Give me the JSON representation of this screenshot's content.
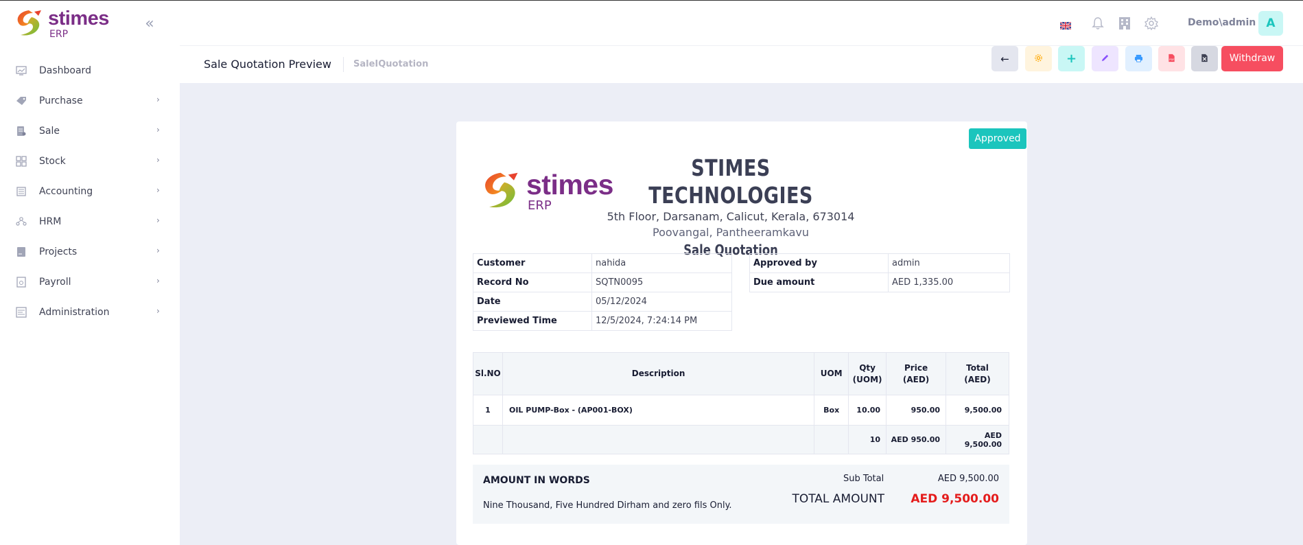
{
  "app": {
    "brand_name": "stimes",
    "brand_sub": "ERP"
  },
  "sidebar": {
    "items": [
      {
        "label": "Dashboard",
        "icon": "dashboard-icon"
      },
      {
        "label": "Purchase",
        "icon": "tag-icon"
      },
      {
        "label": "Sale",
        "icon": "receipt-icon"
      },
      {
        "label": "Stock",
        "icon": "grid-icon"
      },
      {
        "label": "Accounting",
        "icon": "book-icon"
      },
      {
        "label": "HRM",
        "icon": "people-icon"
      },
      {
        "label": "Projects",
        "icon": "folder-icon"
      },
      {
        "label": "Payroll",
        "icon": "payslip-icon"
      },
      {
        "label": "Administration",
        "icon": "admin-icon"
      }
    ]
  },
  "header": {
    "user": "Demo\\admin",
    "avatar": "A"
  },
  "subheader": {
    "title": "Sale Quotation Preview",
    "breadcrumb": "SaleIQuotation",
    "withdraw_label": "Withdraw"
  },
  "document": {
    "status": "Approved",
    "company": "STIMES TECHNOLOGIES",
    "address_line1": "5th Floor, Darsanam, Calicut, Kerala, 673014",
    "address_line2": "Poovangal, Pantheeramkavu",
    "doc_type": "Sale Quotation",
    "info_left": [
      {
        "key": "Customer",
        "value": "nahida"
      },
      {
        "key": "Record No",
        "value": "SQTN0095"
      },
      {
        "key": "Date",
        "value": "05/12/2024"
      },
      {
        "key": "Previewed Time",
        "value": "12/5/2024, 7:24:14 PM"
      }
    ],
    "info_right": [
      {
        "key": "Approved by",
        "value": "admin"
      },
      {
        "key": "Due amount",
        "value": "AED 1,335.00"
      }
    ],
    "columns": {
      "slno": "Sl.NO",
      "description": "Description",
      "uom": "UOM",
      "qty1": "Qty",
      "qty2": "(UOM)",
      "price1": "Price",
      "price2": "(AED)",
      "total1": "Total",
      "total2": "(AED)"
    },
    "rows": [
      {
        "slno": "1",
        "description": "OIL PUMP-Box - (AP001-BOX)",
        "uom": "Box",
        "qty": "10.00",
        "price": "950.00",
        "total": "9,500.00"
      }
    ],
    "totals": {
      "qty": "10",
      "price": "AED 950.00",
      "total": "AED 9,500.00"
    },
    "amount_in_words_title": "AMOUNT IN WORDS",
    "amount_in_words": "Nine Thousand, Five Hundred Dirham and zero fils Only.",
    "sub_total_label": "Sub Total",
    "sub_total": "AED 9,500.00",
    "total_amount_label": "TOTAL AMOUNT",
    "total_amount": "AED 9,500.00"
  }
}
